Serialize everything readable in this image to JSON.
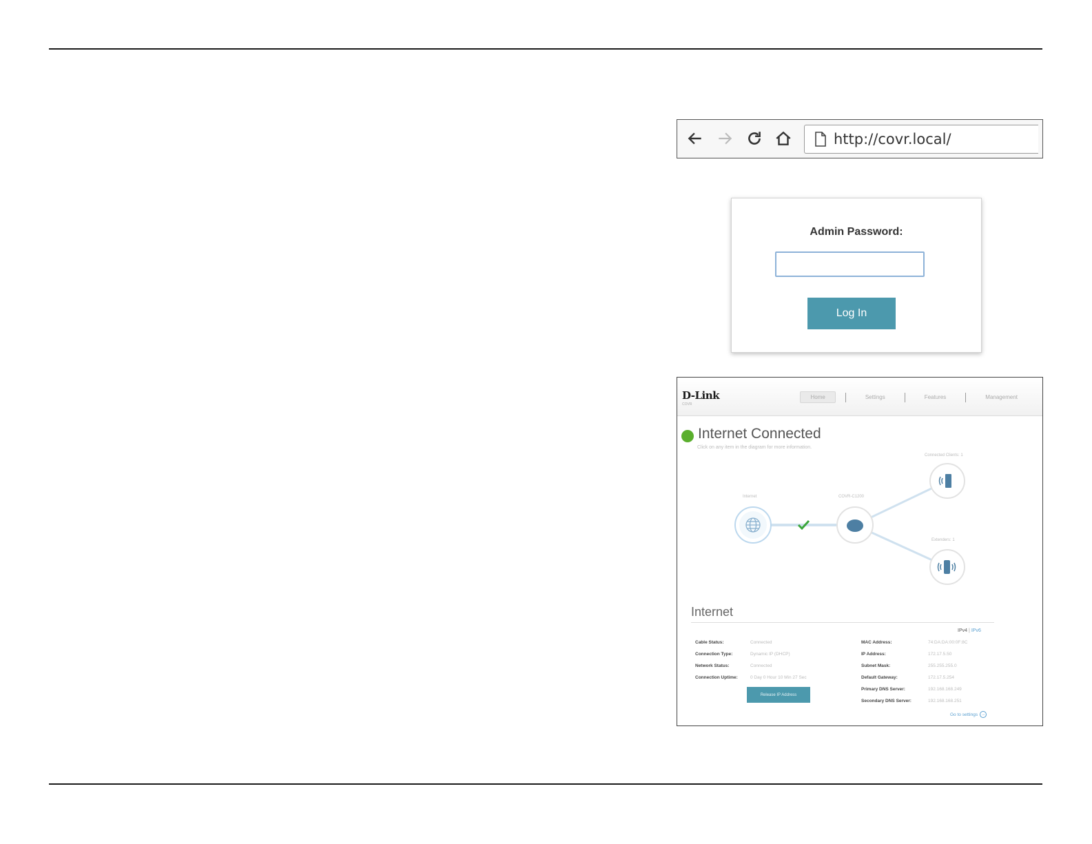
{
  "browser": {
    "url": "http://covr.local/",
    "icons": [
      "back-arrow-icon",
      "forward-arrow-icon",
      "reload-icon",
      "home-icon",
      "page-icon"
    ]
  },
  "login": {
    "label": "Admin Password:",
    "password_value": "",
    "button_label": "Log In"
  },
  "dashboard": {
    "brand": "D-Link",
    "brand_tagline": "COVR",
    "nav": [
      {
        "label": "Home",
        "active": true
      },
      {
        "label": "Settings",
        "active": false
      },
      {
        "label": "Features",
        "active": false
      },
      {
        "label": "Management",
        "active": false
      }
    ],
    "status": {
      "title": "Internet Connected",
      "subtitle": "Click on any item in the diagram for more information.",
      "color": "#5aaf2d"
    },
    "diagram": {
      "internet_label": "Internet",
      "router_label": "COVR-C1200",
      "clients_label": "Connected Clients: 1",
      "extenders_label": "Extenders: 1",
      "icons": [
        "globe-icon",
        "router-icon",
        "wireless-client-icon",
        "extender-icon",
        "checkmark-icon"
      ]
    },
    "internet": {
      "title": "Internet",
      "ipv4": "IPv4",
      "ipv6": "IPv6",
      "left": [
        {
          "key": "Cable Status:",
          "value": "Connected"
        },
        {
          "key": "Connection Type:",
          "value": "Dynamic IP (DHCP)"
        },
        {
          "key": "Network Status:",
          "value": "Connected"
        },
        {
          "key": "Connection Uptime:",
          "value": "0 Day 0 Hour 10 Min 27 Sec"
        }
      ],
      "right": [
        {
          "key": "MAC Address:",
          "value": "74:DA:DA:00:0F:8C"
        },
        {
          "key": "IP Address:",
          "value": "172.17.5.50"
        },
        {
          "key": "Subnet Mask:",
          "value": "255.255.255.0"
        },
        {
          "key": "Default Gateway:",
          "value": "172.17.5.254"
        },
        {
          "key": "Primary DNS Server:",
          "value": "192.168.168.249"
        },
        {
          "key": "Secondary DNS Server:",
          "value": "192.168.168.251"
        }
      ],
      "renew_button": "Release IP Address",
      "settings_link": "Go to settings"
    },
    "accent": "#4c99ad"
  }
}
